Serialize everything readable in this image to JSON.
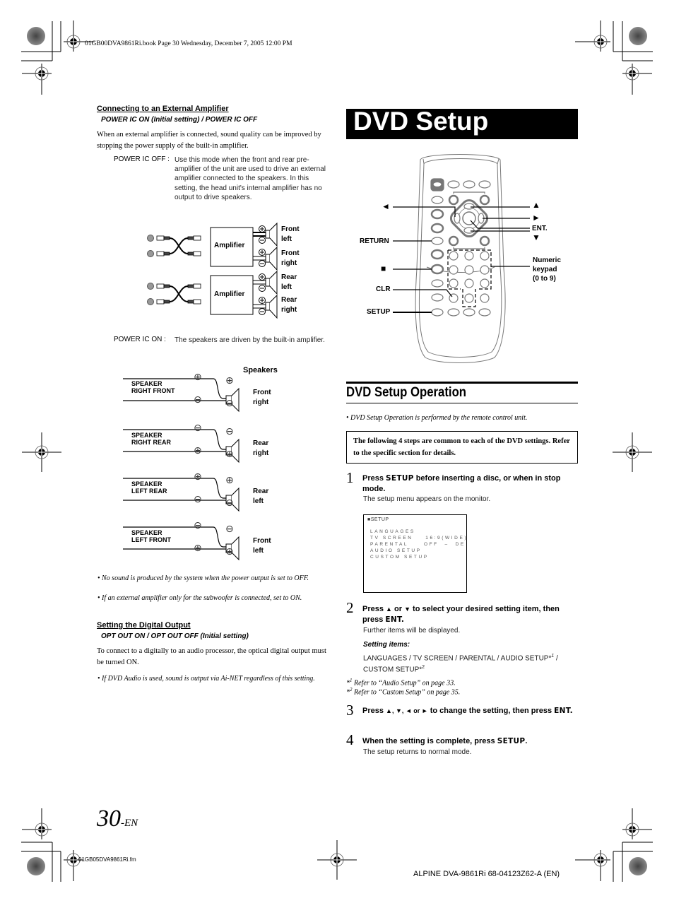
{
  "print_header": {
    "book_line": "01GB00DVA9861Ri.book  Page 30  Wednesday, December 7, 2005  12:00 PM"
  },
  "left": {
    "ext_amp": {
      "heading": "Connecting to an External Amplifier",
      "subheading": "POWER IC ON (Initial setting) / POWER IC OFF",
      "intro": "When an external amplifier is connected, sound quality can be improved by stopping the power supply of the built-in amplifier.",
      "off_term": "POWER IC OFF :",
      "off_text": "Use this mode when the front and rear pre-amplifier of the unit are used to drive an external amplifier connected to the speakers. In this setting, the head unit's internal amplifier has no output to drive speakers.",
      "amp_diagram": {
        "amplifier_label": "Amplifier",
        "outputs": [
          {
            "line1": "Front",
            "line2": "left"
          },
          {
            "line1": "Front",
            "line2": "right"
          },
          {
            "line1": "Rear",
            "line2": "left"
          },
          {
            "line1": "Rear",
            "line2": "right"
          }
        ]
      },
      "on_term": "POWER IC ON :",
      "on_text": "The speakers are driven by the built-in amplifier.",
      "speaker_diagram": {
        "title": "Speakers",
        "rows": [
          {
            "wire1": "SPEAKER",
            "wire2": "RIGHT FRONT",
            "top_sign": "+",
            "bottom_sign": "−",
            "line1": "Front",
            "line2": "right"
          },
          {
            "wire1": "SPEAKER",
            "wire2": "RIGHT REAR",
            "top_sign": "−",
            "bottom_sign": "+",
            "line1": "Rear",
            "line2": "right"
          },
          {
            "wire1": "SPEAKER",
            "wire2": "LEFT REAR",
            "top_sign": "+",
            "bottom_sign": "−",
            "line1": "Rear",
            "line2": "left"
          },
          {
            "wire1": "SPEAKER",
            "wire2": "LEFT FRONT",
            "top_sign": "−",
            "bottom_sign": "+",
            "line1": "Front",
            "line2": "left"
          }
        ]
      },
      "notes": [
        "No sound is produced by the system when the power output is set to OFF.",
        "If an external amplifier only for the subwoofer is connected, set to ON."
      ]
    },
    "digital_out": {
      "heading": "Setting the Digital Output",
      "subheading": "OPT OUT ON / OPT OUT OFF (Initial setting)",
      "body": "To connect to a digitally to an audio processor, the optical digital output must be turned ON.",
      "note": "If DVD Audio is used, sound is output via Ai-NET regardless of this setting."
    }
  },
  "right": {
    "title": "DVD Setup",
    "remote_labels": {
      "left": "◄",
      "up": "▲",
      "right": "►",
      "ent": "ENT.",
      "down": "▼",
      "return": "RETURN",
      "stop": "■",
      "clr": "CLR",
      "setup": "SETUP",
      "keypad_1": "Numeric",
      "keypad_2": "keypad",
      "keypad_3": "(0 to 9)"
    },
    "section_title": "DVD Setup Operation",
    "section_note": "DVD Setup Operation is performed by the remote control unit.",
    "box_text": "The following 4 steps are common to each of the DVD settings. Refer to the specific section for details.",
    "steps": [
      {
        "num": "1",
        "pre": "Press ",
        "kw": "SETUP",
        "post": " before inserting a disc, or when in stop mode.",
        "body": "The setup menu appears on the monitor."
      },
      {
        "num": "2",
        "pre": "Press ",
        "sym1": "▲",
        "mid": " or ",
        "sym2": "▼",
        "post": " to select your desired setting item, then press ",
        "kw": "ENT.",
        "body": "Further items will be displayed.",
        "items_label": "Setting items:",
        "items_text": "LANGUAGES / TV SCREEN / PARENTAL / AUDIO SETUP*",
        "items_sup1": "1",
        "items_text2": " / CUSTOM SETUP*",
        "items_sup2": "2"
      },
      {
        "num": "3",
        "pre": "Press ",
        "syms": "▲, ▼, ◄ or ►",
        "post": " to change the setting, then press ",
        "kw": "ENT."
      },
      {
        "num": "4",
        "pre": "When the setting is complete, press ",
        "kw": "SETUP",
        "post": ".",
        "body": "The setup returns to normal mode."
      }
    ],
    "screen": {
      "title": "■SETUP",
      "rows": [
        "LANGUAGES",
        "TV SCREEN    16:9(WIDE)",
        "PARENTAL     OFF  –  DE",
        "AUDIO SETUP",
        "CUSTOM SETUP"
      ]
    },
    "footnotes": [
      {
        "mark": "*",
        "sup": "1",
        "text": " Refer to “Audio Setup” on page 33."
      },
      {
        "mark": "*",
        "sup": "2",
        "text": " Refer to “Custom Setup” on page 35."
      }
    ]
  },
  "footer": {
    "page_number": "30",
    "page_suffix": "-EN",
    "fm_line": "01GB05DVA9861Ri.fm",
    "model_line": "ALPINE DVA-9861Ri 68-04123Z62-A (EN)"
  }
}
